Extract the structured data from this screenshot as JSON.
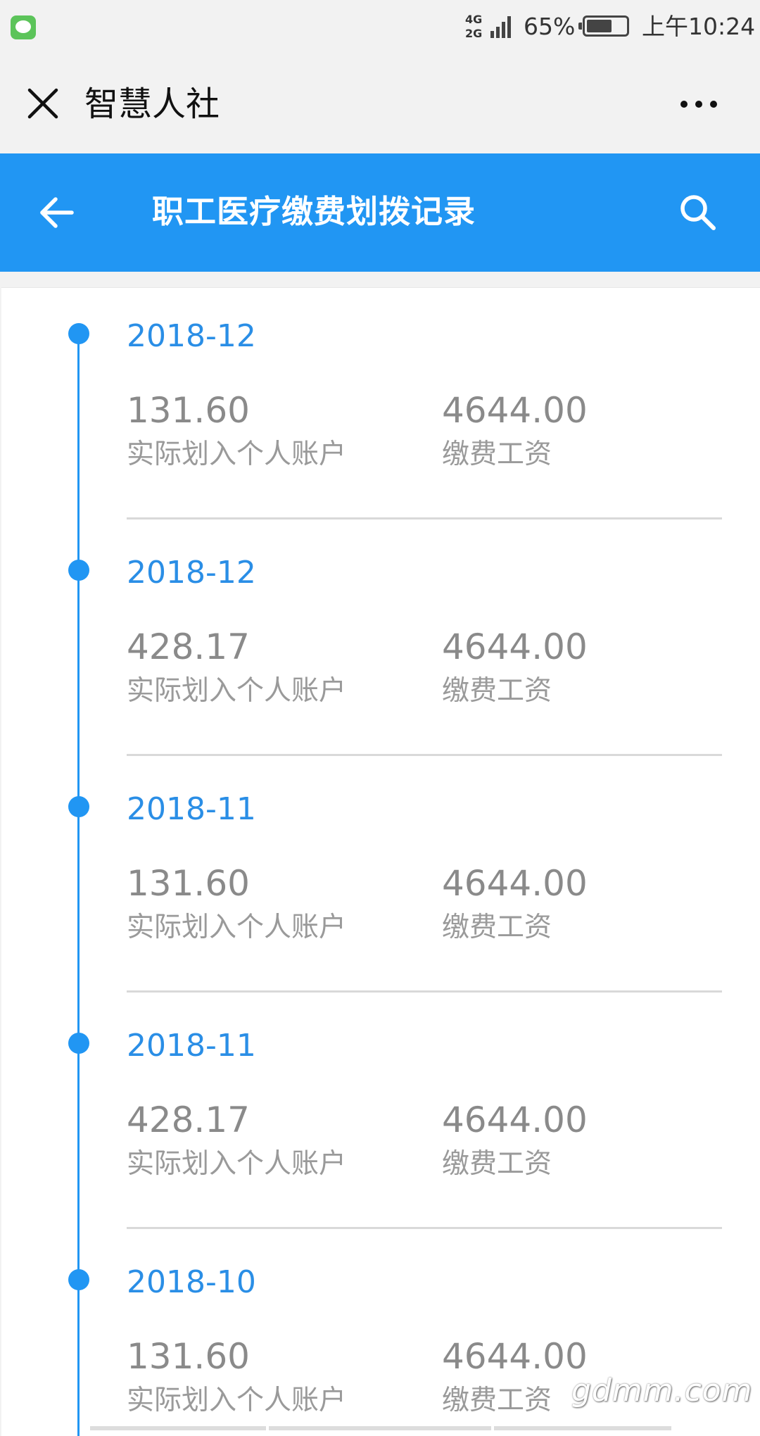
{
  "status_bar": {
    "network_top": "4G",
    "network_bottom": "2G",
    "battery_percent": "65%",
    "battery_level": 0.65,
    "time": "上午10:24",
    "notification_icon": "wechat-icon"
  },
  "wechat_header": {
    "title": "智慧人社",
    "close_icon": "close-icon",
    "more_icon": "more-icon"
  },
  "app_bar": {
    "title": "职工医疗缴费划拨记录",
    "background_color": "#2196f3",
    "back_icon": "arrow-left-icon",
    "search_icon": "search-icon"
  },
  "records": [
    {
      "date": "2018-12",
      "amount": "131.60",
      "amount_label": "实际划入个人账户",
      "wage": "4644.00",
      "wage_label": "缴费工资"
    },
    {
      "date": "2018-12",
      "amount": "428.17",
      "amount_label": "实际划入个人账户",
      "wage": "4644.00",
      "wage_label": "缴费工资"
    },
    {
      "date": "2018-11",
      "amount": "131.60",
      "amount_label": "实际划入个人账户",
      "wage": "4644.00",
      "wage_label": "缴费工资"
    },
    {
      "date": "2018-11",
      "amount": "428.17",
      "amount_label": "实际划入个人账户",
      "wage": "4644.00",
      "wage_label": "缴费工资"
    },
    {
      "date": "2018-10",
      "amount": "131.60",
      "amount_label": "实际划入个人账户",
      "wage": "4644.00",
      "wage_label": "缴费工资"
    }
  ],
  "watermark": "gdmm.com"
}
